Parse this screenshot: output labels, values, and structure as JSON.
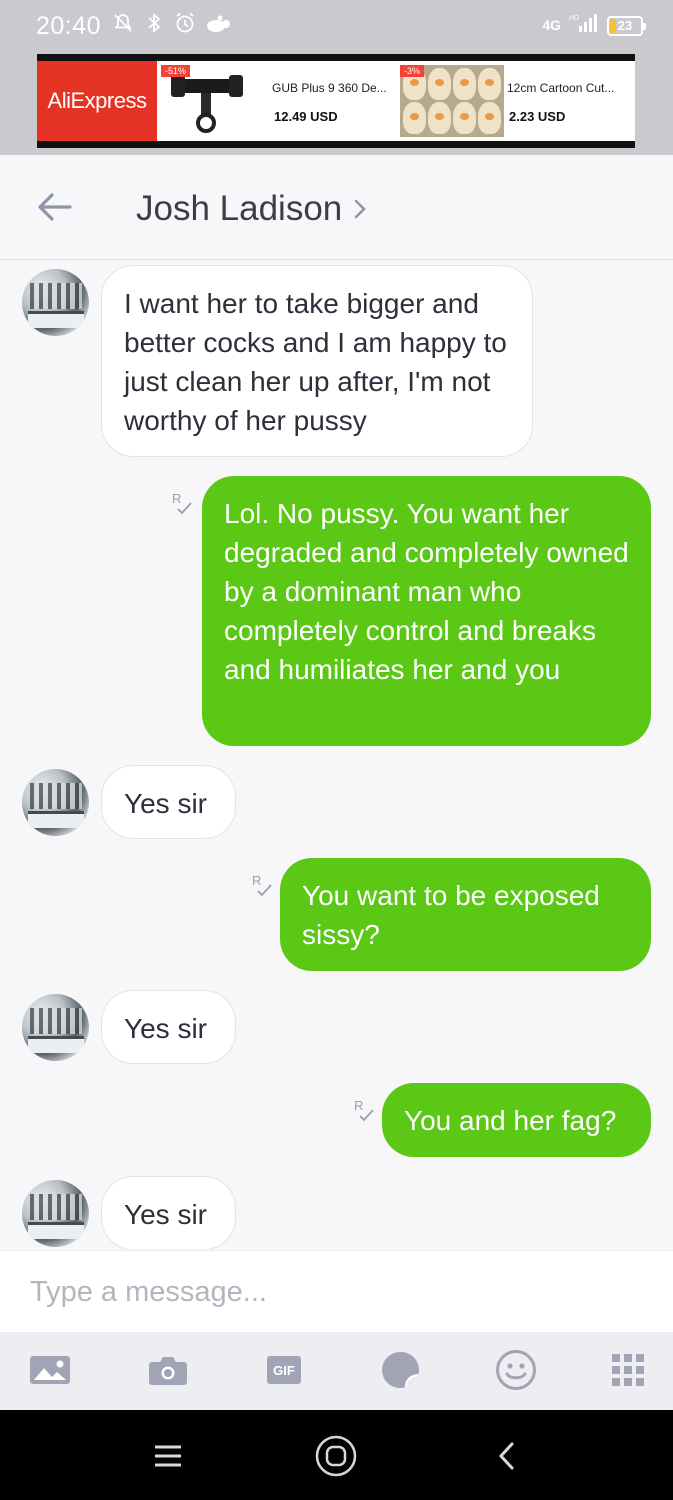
{
  "status_bar": {
    "time": "20:40",
    "network": "4G",
    "network_hd": "HD",
    "battery": "23"
  },
  "ad": {
    "brand": "AliExpress",
    "products": [
      {
        "badge": "-51%",
        "name": "GUB Plus 9 360 De...",
        "price": "12.49 USD"
      },
      {
        "badge": "-3%",
        "name": "12cm Cartoon Cut...",
        "price": "2.23 USD"
      }
    ]
  },
  "header": {
    "contact_name": "Josh Ladison"
  },
  "messages": [
    {
      "from": "them",
      "text": "I want her to take bigger and better cocks and I am happy to just clean her up after, I'm not worthy of her pussy"
    },
    {
      "from": "me",
      "read_mark": "R",
      "text": "Lol. No pussy. You want her degraded and completely owned by a dominant man who completely control and breaks and humiliates her and you"
    },
    {
      "from": "them",
      "text": "Yes sir"
    },
    {
      "from": "me",
      "read_mark": "R",
      "text": "You want to be exposed sissy?"
    },
    {
      "from": "them",
      "text": "Yes sir"
    },
    {
      "from": "me",
      "read_mark": "R",
      "text": "You and her fag?"
    },
    {
      "from": "them",
      "text": "Yes sir"
    }
  ],
  "composer": {
    "placeholder": "Type a message..."
  },
  "toolbar": {
    "gif_label": "GIF",
    "icons": [
      "image-icon",
      "camera-icon",
      "gif-icon",
      "sticker-icon",
      "emoji-icon",
      "apps-grid-icon"
    ]
  },
  "colors": {
    "outgoing_bubble": "#5ac814",
    "incoming_bubble": "#ffffff",
    "ad_brand": "#e43225"
  }
}
